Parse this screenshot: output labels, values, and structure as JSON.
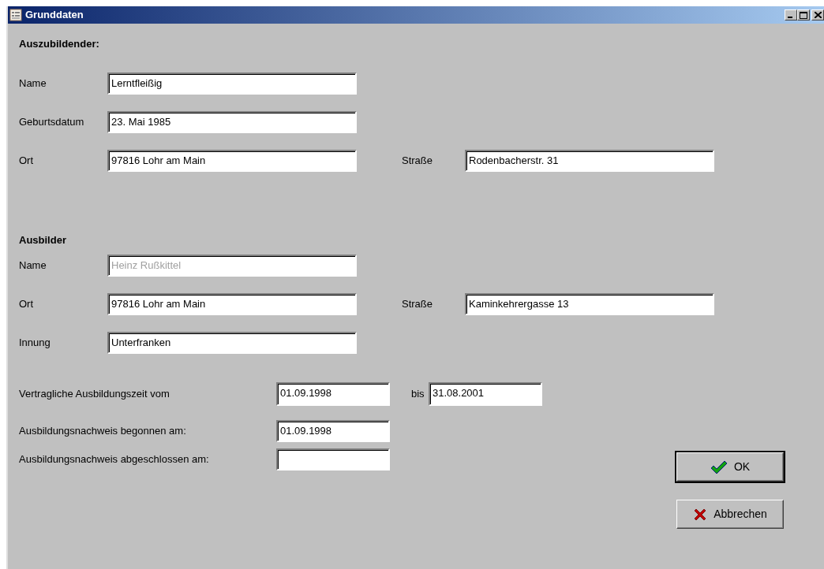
{
  "window": {
    "title": "Grunddaten"
  },
  "sections": [
    {
      "heading": "Auszubildender:",
      "rows": [
        {
          "fields": [
            {
              "label": "Name",
              "value": "Lerntfleißig",
              "disabled": false
            }
          ]
        },
        {
          "fields": [
            {
              "label": "Geburtsdatum",
              "value": "23. Mai 1985",
              "disabled": false
            }
          ]
        },
        {
          "fields": [
            {
              "label": "Ort",
              "value": "97816 Lohr am Main",
              "disabled": false
            },
            {
              "label": "Straße",
              "value": "Rodenbacherstr. 31",
              "disabled": false
            }
          ]
        }
      ]
    },
    {
      "heading": "Ausbilder",
      "rows": [
        {
          "fields": [
            {
              "label": "Name",
              "value": "Heinz Rußkittel",
              "disabled": true
            }
          ]
        },
        {
          "fields": [
            {
              "label": "Ort",
              "value": "97816 Lohr am Main",
              "disabled": false
            },
            {
              "label": "Straße",
              "value": "Kaminkehrergasse 13",
              "disabled": false
            }
          ]
        },
        {
          "fields": [
            {
              "label": "Innung",
              "value": "Unterfranken",
              "disabled": false
            }
          ]
        }
      ]
    }
  ],
  "period": {
    "label": "Vertragliche Ausbildungszeit vom",
    "from": "01.09.1998",
    "to_label": "bis",
    "to": "31.08.2001"
  },
  "records": [
    {
      "label": "Ausbildungsnachweis begonnen am:",
      "value": "01.09.1998"
    },
    {
      "label": "Ausbildungsnachweis abgeschlossen am:"
    }
  ],
  "buttons": [
    {
      "label": "OK",
      "kind": "ok",
      "default": true
    },
    {
      "label": "Abbrechen",
      "kind": "cancel",
      "default": false
    }
  ]
}
